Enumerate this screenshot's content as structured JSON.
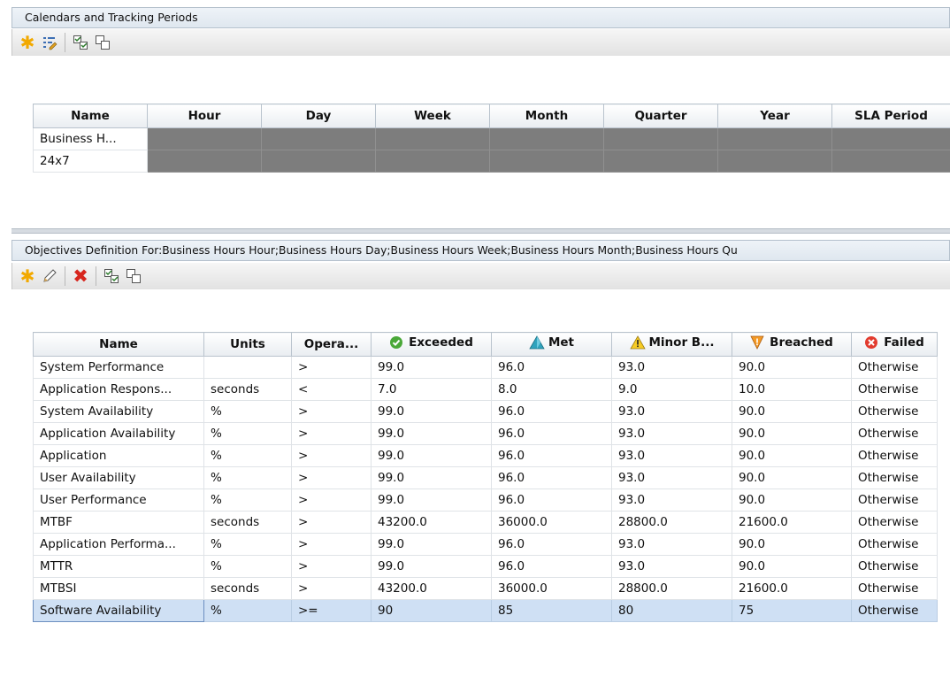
{
  "calendars_panel": {
    "title": "Calendars and Tracking Periods",
    "toolbar": [
      {
        "icon": "new-star-icon"
      },
      {
        "icon": "edit-list-icon"
      },
      {
        "separator": true
      },
      {
        "icon": "select-all-icon"
      },
      {
        "icon": "copy-icon"
      }
    ],
    "table": {
      "columns": [
        "Name",
        "Hour",
        "Day",
        "Week",
        "Month",
        "Quarter",
        "Year",
        "SLA Period"
      ],
      "rows": [
        "Business H...",
        "24x7"
      ]
    }
  },
  "objectives_panel": {
    "title": "Objectives Definition For:Business Hours Hour;Business Hours Day;Business Hours Week;Business Hours Month;Business Hours Qu",
    "toolbar": [
      {
        "icon": "new-star-icon"
      },
      {
        "icon": "edit-pencil-icon"
      },
      {
        "separator": true
      },
      {
        "icon": "delete-x-icon"
      },
      {
        "separator": true
      },
      {
        "icon": "select-all-icon"
      },
      {
        "icon": "copy-icon"
      }
    ],
    "table": {
      "columns": [
        {
          "label": "Name"
        },
        {
          "label": "Units"
        },
        {
          "label": "Opera..."
        },
        {
          "label": "Exceeded",
          "icon": "green-check-icon"
        },
        {
          "label": "Met",
          "icon": "blue-triangle-icon"
        },
        {
          "label": "Minor B...",
          "icon": "warning-triangle-icon"
        },
        {
          "label": "Breached",
          "icon": "breached-shield-icon"
        },
        {
          "label": "Failed",
          "icon": "red-x-circle-icon"
        }
      ],
      "rows": [
        [
          "System Performance",
          "",
          ">",
          "99.0",
          "96.0",
          "93.0",
          "90.0",
          "Otherwise"
        ],
        [
          "Application Respons...",
          "seconds",
          "<",
          "7.0",
          "8.0",
          "9.0",
          "10.0",
          "Otherwise"
        ],
        [
          "System Availability",
          "%",
          ">",
          "99.0",
          "96.0",
          "93.0",
          "90.0",
          "Otherwise"
        ],
        [
          "Application Availability",
          "%",
          ">",
          "99.0",
          "96.0",
          "93.0",
          "90.0",
          "Otherwise"
        ],
        [
          "Application",
          "%",
          ">",
          "99.0",
          "96.0",
          "93.0",
          "90.0",
          "Otherwise"
        ],
        [
          "User Availability",
          "%",
          ">",
          "99.0",
          "96.0",
          "93.0",
          "90.0",
          "Otherwise"
        ],
        [
          "User Performance",
          "%",
          ">",
          "99.0",
          "96.0",
          "93.0",
          "90.0",
          "Otherwise"
        ],
        [
          "MTBF",
          "seconds",
          ">",
          "43200.0",
          "36000.0",
          "28800.0",
          "21600.0",
          "Otherwise"
        ],
        [
          "Application Performa...",
          "%",
          ">",
          "99.0",
          "96.0",
          "93.0",
          "90.0",
          "Otherwise"
        ],
        [
          "MTTR",
          "%",
          ">",
          "99.0",
          "96.0",
          "93.0",
          "90.0",
          "Otherwise"
        ],
        [
          "MTBSI",
          "seconds",
          ">",
          "43200.0",
          "36000.0",
          "28800.0",
          "21600.0",
          "Otherwise"
        ],
        [
          "Software Availability",
          "%",
          ">=",
          "90",
          "85",
          "80",
          "75",
          "Otherwise"
        ]
      ],
      "selected_row": 11
    }
  },
  "colors": {
    "selected_row": "#cfe0f4",
    "gray_cells": "#7d7d7d",
    "star": "#f2a900",
    "delete": "#d7261e"
  }
}
